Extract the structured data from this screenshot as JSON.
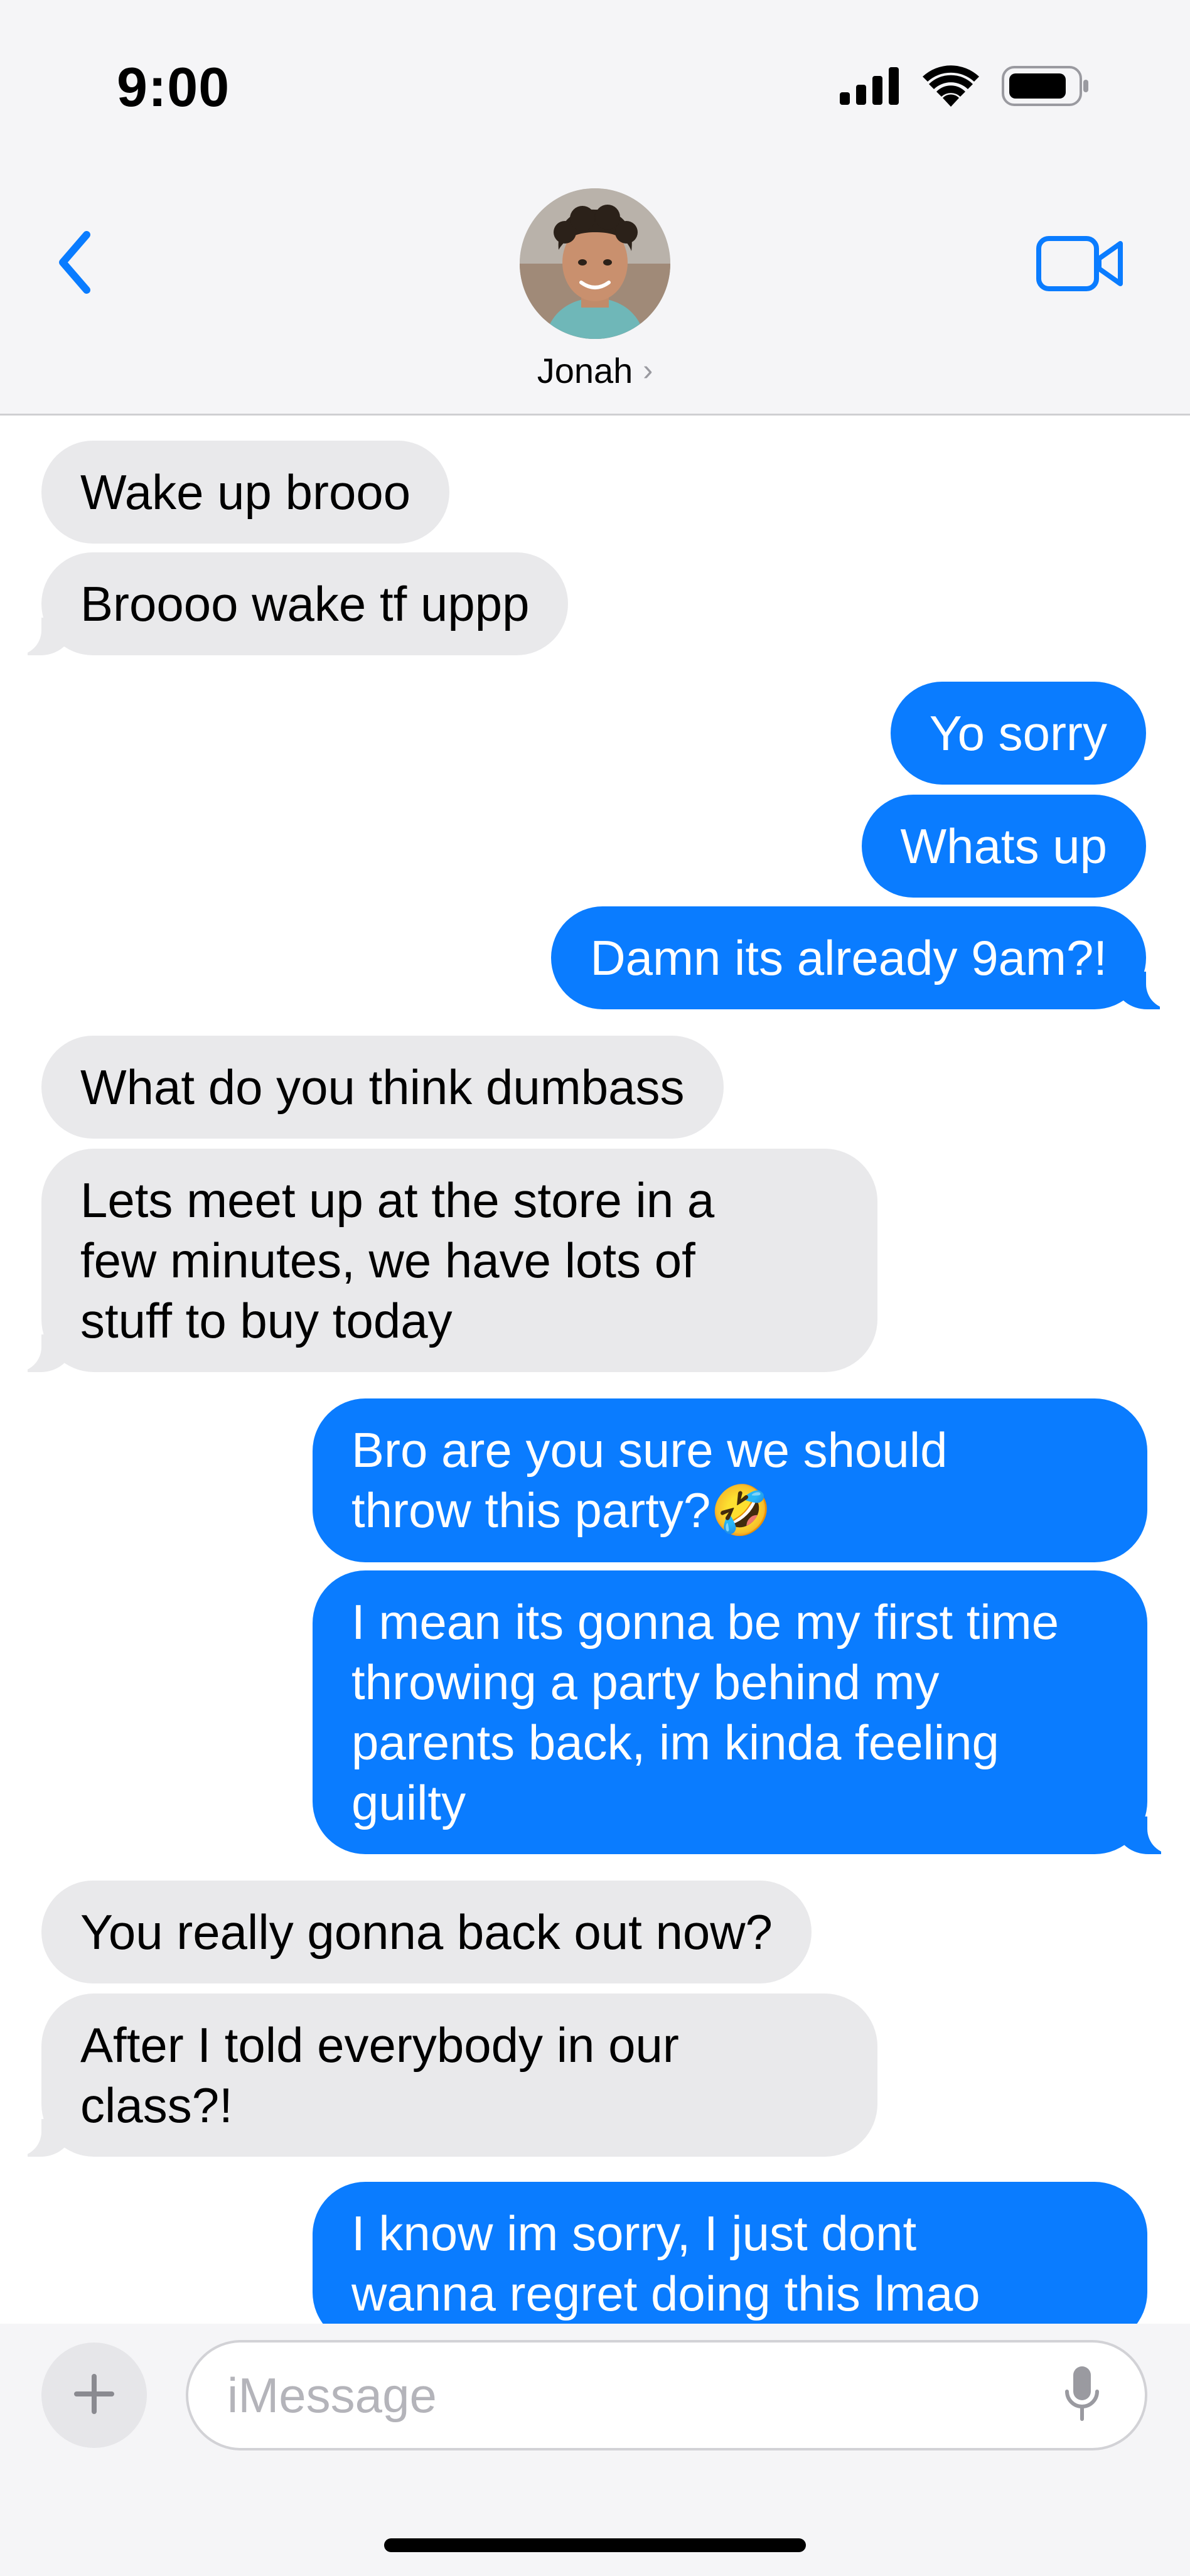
{
  "status_bar": {
    "time": "9:00",
    "icons": [
      "cellular-signal-icon",
      "wifi-icon",
      "battery-icon"
    ]
  },
  "header": {
    "contact_name": "Jonah",
    "chevron": "›",
    "icons": [
      "back-chevron-icon",
      "video-camera-icon"
    ]
  },
  "messages": [
    {
      "direction": "in",
      "text": "Wake up brooo"
    },
    {
      "direction": "in",
      "text": "Broooo wake tf uppp"
    },
    {
      "direction": "out",
      "text": "Yo sorry"
    },
    {
      "direction": "out",
      "text": "Whats up"
    },
    {
      "direction": "out",
      "text": "Damn its already 9am?!"
    },
    {
      "direction": "in",
      "text": "What do you think dumbass"
    },
    {
      "direction": "in",
      "lines": [
        "Lets meet up at the store in a",
        "few minutes, we have lots of",
        "stuff to buy today"
      ]
    },
    {
      "direction": "out",
      "lines": [
        "Bro are you sure we should",
        "throw this party?"
      ],
      "emoji": "🤣"
    },
    {
      "direction": "out",
      "lines": [
        "I mean its gonna be my first time",
        "throwing a party behind my",
        "parents back, im kinda feeling",
        "guilty"
      ]
    },
    {
      "direction": "in",
      "text": "You really gonna back out now?"
    },
    {
      "direction": "in",
      "lines": [
        "After I told everybody in our",
        "class?!"
      ]
    },
    {
      "direction": "out",
      "lines": [
        "I know im sorry, I just dont",
        "wanna regret doing this lmao"
      ]
    }
  ],
  "composer": {
    "placeholder": "iMessage",
    "value": "",
    "icons": [
      "plus-icon",
      "microphone-icon"
    ]
  },
  "colors": {
    "outgoing_bubble": "#0a7cff",
    "incoming_bubble": "#e9e9eb",
    "accent": "#0a7cff",
    "header_bg": "#f5f5f7"
  }
}
